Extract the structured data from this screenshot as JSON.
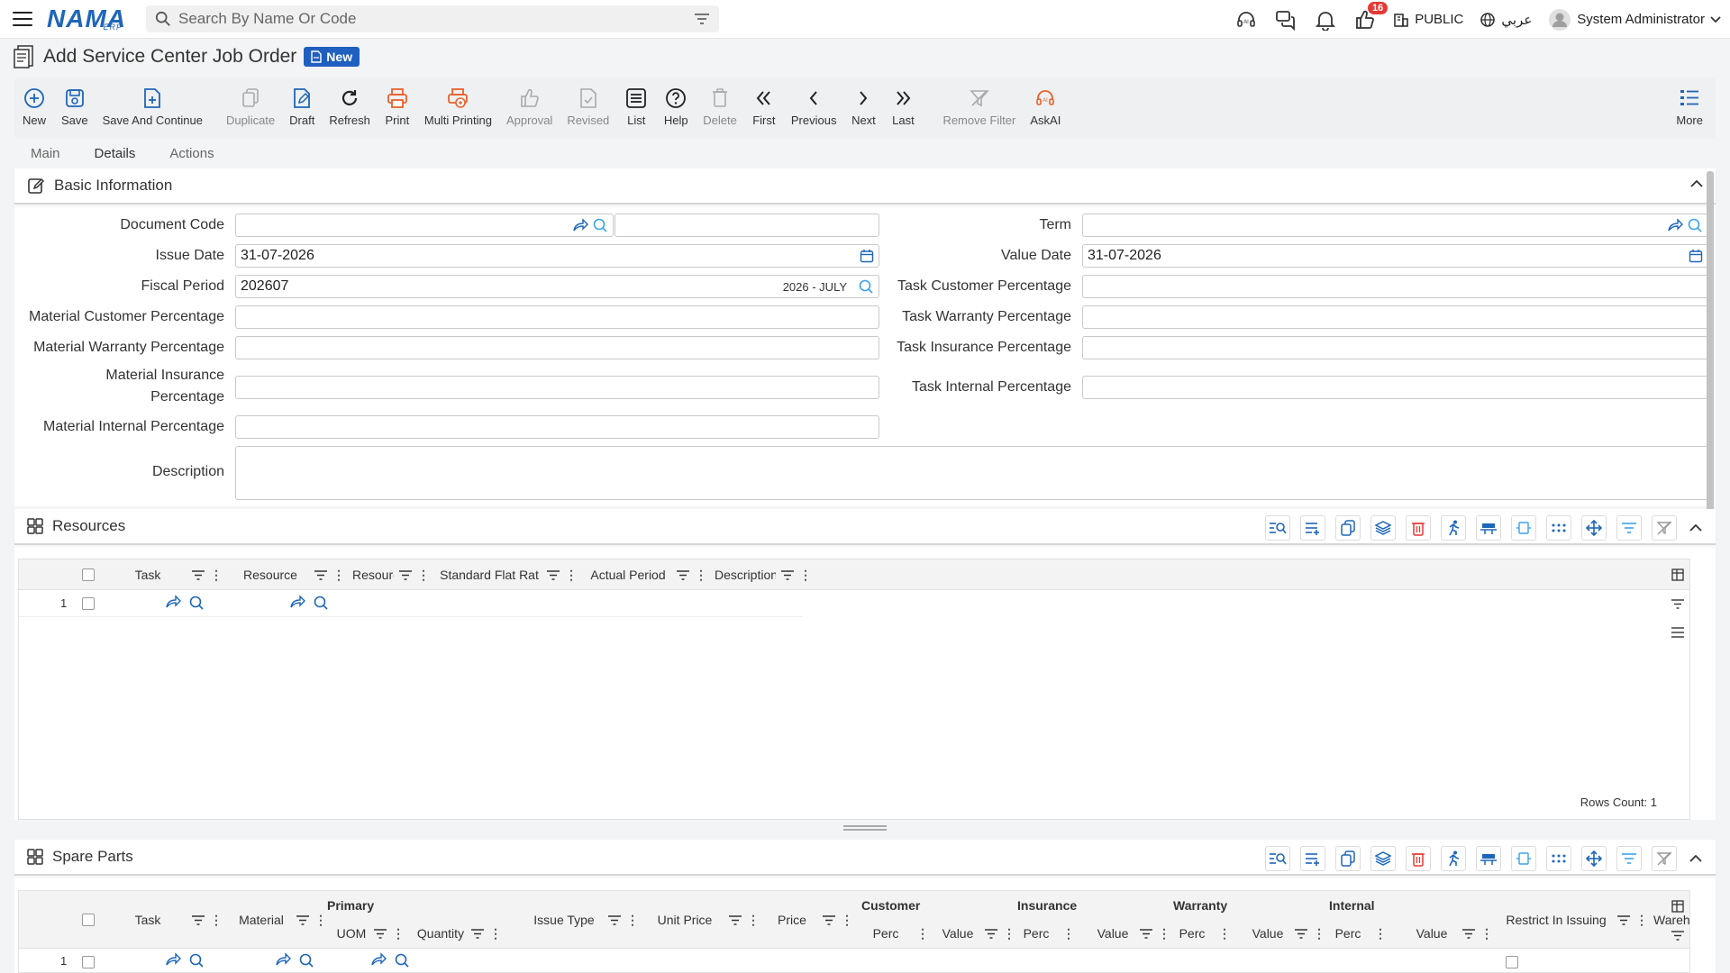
{
  "header": {
    "logo": "NAMA",
    "logo_sub": "ERP",
    "search_placeholder": "Search By Name Or Code",
    "notifications_count": "16",
    "public_label": "PUBLIC",
    "language_label": "عربي",
    "user_name": "System Administrator",
    "icons": [
      "menu-icon",
      "search-icon",
      "filter-icon",
      "ai-headset-icon",
      "chat-icon",
      "bell-icon",
      "thumbs-up-icon",
      "building-icon",
      "globe-icon",
      "user-avatar-icon",
      "chevron-down-icon"
    ]
  },
  "page": {
    "title": "Add Service Center Job Order",
    "status_badge": "New"
  },
  "toolbar": {
    "new": "New",
    "save": "Save",
    "save_continue": "Save And Continue",
    "duplicate": "Duplicate",
    "draft": "Draft",
    "refresh": "Refresh",
    "print": "Print",
    "multi_printing": "Multi Printing",
    "approval": "Approval",
    "revised": "Revised",
    "list": "List",
    "help": "Help",
    "delete": "Delete",
    "first": "First",
    "previous": "Previous",
    "next": "Next",
    "last": "Last",
    "remove_filter": "Remove Filter",
    "askai": "AskAI",
    "more": "More"
  },
  "tabs": {
    "main": "Main",
    "details": "Details",
    "actions": "Actions",
    "active": "Details"
  },
  "basic_info": {
    "title": "Basic Information",
    "document_code_label": "Document Code",
    "document_code": "",
    "issue_date_label": "Issue Date",
    "issue_date": "31-07-2026",
    "fiscal_period_label": "Fiscal Period",
    "fiscal_period": "202607",
    "fiscal_period_name": "2026 - JULY",
    "material_customer_label": "Material Customer Percentage",
    "material_warranty_label": "Material Warranty Percentage",
    "material_insurance_label_1": "Material Insurance",
    "material_insurance_label_2": "Percentage",
    "material_internal_label": "Material Internal Percentage",
    "term_label": "Term",
    "value_date_label": "Value Date",
    "value_date": "31-07-2026",
    "task_customer_label": "Task Customer Percentage",
    "task_warranty_label": "Task Warranty Percentage",
    "task_insurance_label": "Task Insurance Percentage",
    "task_internal_label": "Task Internal Percentage",
    "description_label": "Description"
  },
  "resources": {
    "title": "Resources",
    "columns": [
      "Task",
      "Resource",
      "Resourc",
      "Standard Flat Rat",
      "Actual Period",
      "Description"
    ],
    "row_number": "1",
    "rows_count": "Rows Count: 1"
  },
  "spare_parts": {
    "title": "Spare Parts",
    "columns": {
      "task": "Task",
      "material": "Material",
      "primary_group": "Primary",
      "uom": "UOM",
      "quantity": "Quantity",
      "issue_type": "Issue Type",
      "unit_price": "Unit Price",
      "price": "Price",
      "customer_group": "Customer",
      "insurance_group": "Insurance",
      "warranty_group": "Warranty",
      "internal_group": "Internal",
      "perc": "Perc",
      "value": "Value",
      "restrict": "Restrict In Issuing",
      "wareh": "Wareh"
    },
    "row_number": "1"
  },
  "colors": {
    "brand": "#1e66b8",
    "accent_orange": "#e8612c",
    "danger": "#e53935"
  }
}
